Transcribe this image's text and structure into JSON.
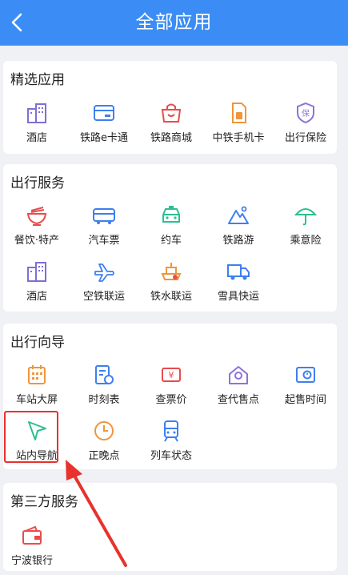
{
  "header": {
    "title": "全部应用"
  },
  "sections": [
    {
      "title": "精选应用",
      "items": [
        {
          "label": "酒店",
          "icon": "hotel-icon"
        },
        {
          "label": "铁路e卡通",
          "icon": "card-icon"
        },
        {
          "label": "铁路商城",
          "icon": "shop-icon"
        },
        {
          "label": "中铁手机卡",
          "icon": "sim-card-icon"
        },
        {
          "label": "出行保险",
          "icon": "insurance-shield-icon"
        }
      ]
    },
    {
      "title": "出行服务",
      "items": [
        {
          "label": "餐饮·特产",
          "icon": "noodle-bowl-icon"
        },
        {
          "label": "汽车票",
          "icon": "bus-icon"
        },
        {
          "label": "约车",
          "icon": "taxi-icon"
        },
        {
          "label": "铁路游",
          "icon": "mountain-icon"
        },
        {
          "label": "乘意险",
          "icon": "umbrella-icon"
        },
        {
          "label": "酒店",
          "icon": "hotel-icon"
        },
        {
          "label": "空铁联运",
          "icon": "plane-icon"
        },
        {
          "label": "铁水联运",
          "icon": "ship-icon"
        },
        {
          "label": "雪具快运",
          "icon": "truck-icon"
        }
      ]
    },
    {
      "title": "出行向导",
      "items": [
        {
          "label": "车站大屏",
          "icon": "calendar-grid-icon"
        },
        {
          "label": "时刻表",
          "icon": "timetable-icon"
        },
        {
          "label": "查票价",
          "icon": "price-tag-icon"
        },
        {
          "label": "查代售点",
          "icon": "agency-home-icon"
        },
        {
          "label": "起售时间",
          "icon": "ticket-clock-icon"
        },
        {
          "label": "站内导航",
          "icon": "navigation-arrow-icon"
        },
        {
          "label": "正晚点",
          "icon": "clock-icon"
        },
        {
          "label": "列车状态",
          "icon": "train-icon"
        }
      ]
    },
    {
      "title": "第三方服务",
      "items": [
        {
          "label": "宁波银行",
          "icon": "wallet-icon"
        }
      ]
    }
  ],
  "colors": {
    "header": "#3b8df5",
    "highlight": "#e8322c",
    "blue": "#3e7ff0",
    "orange": "#f0953a",
    "red": "#e84c4c",
    "green": "#2cbf91",
    "purple": "#8b73d9"
  }
}
